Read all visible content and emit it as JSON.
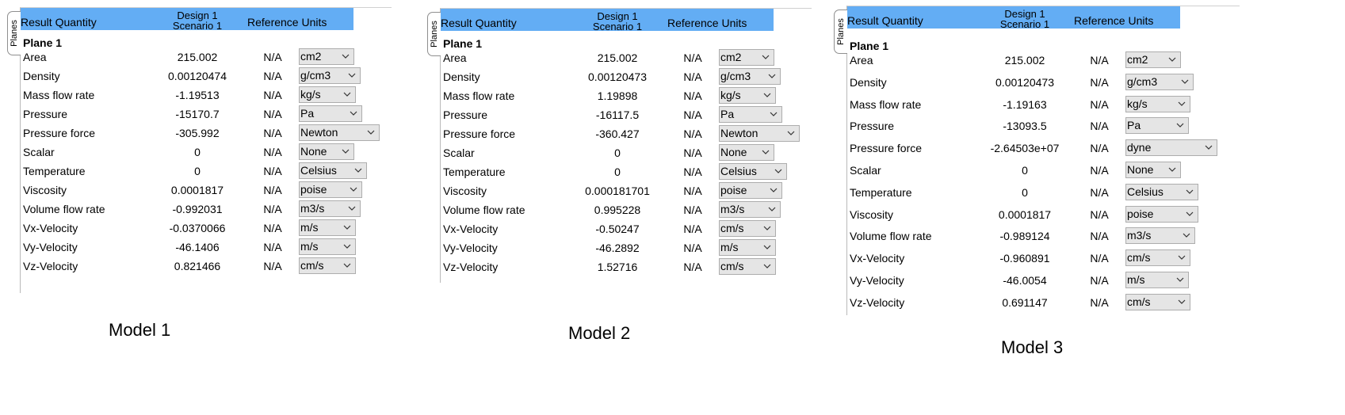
{
  "tab_label": "Planes",
  "columns": {
    "quantity": "Result Quantity",
    "design_line1": "Design 1",
    "design_line2": "Scenario 1",
    "reference": "Reference Units"
  },
  "models": [
    {
      "caption": "Model 1",
      "plane": "Plane 1",
      "rows": [
        {
          "quantity": "Area",
          "value": "215.002",
          "reference": "N/A",
          "unit": "cm2"
        },
        {
          "quantity": "Density",
          "value": "0.00120474",
          "reference": "N/A",
          "unit": "g/cm3"
        },
        {
          "quantity": "Mass flow rate",
          "value": "-1.19513",
          "reference": "N/A",
          "unit": "kg/s"
        },
        {
          "quantity": "Pressure",
          "value": "-15170.7",
          "reference": "N/A",
          "unit": "Pa"
        },
        {
          "quantity": "Pressure force",
          "value": "-305.992",
          "reference": "N/A",
          "unit": "Newton"
        },
        {
          "quantity": "Scalar",
          "value": "0",
          "reference": "N/A",
          "unit": "None"
        },
        {
          "quantity": "Temperature",
          "value": "0",
          "reference": "N/A",
          "unit": "Celsius"
        },
        {
          "quantity": "Viscosity",
          "value": "0.0001817",
          "reference": "N/A",
          "unit": "poise"
        },
        {
          "quantity": "Volume flow rate",
          "value": "-0.992031",
          "reference": "N/A",
          "unit": "m3/s"
        },
        {
          "quantity": "Vx-Velocity",
          "value": "-0.0370066",
          "reference": "N/A",
          "unit": "m/s"
        },
        {
          "quantity": "Vy-Velocity",
          "value": "-46.1406",
          "reference": "N/A",
          "unit": "m/s"
        },
        {
          "quantity": "Vz-Velocity",
          "value": "0.821466",
          "reference": "N/A",
          "unit": "cm/s"
        }
      ]
    },
    {
      "caption": "Model 2",
      "plane": "Plane 1",
      "rows": [
        {
          "quantity": "Area",
          "value": "215.002",
          "reference": "N/A",
          "unit": "cm2"
        },
        {
          "quantity": "Density",
          "value": "0.00120473",
          "reference": "N/A",
          "unit": "g/cm3"
        },
        {
          "quantity": "Mass flow rate",
          "value": "1.19898",
          "reference": "N/A",
          "unit": "kg/s"
        },
        {
          "quantity": "Pressure",
          "value": "-16117.5",
          "reference": "N/A",
          "unit": "Pa"
        },
        {
          "quantity": "Pressure force",
          "value": "-360.427",
          "reference": "N/A",
          "unit": "Newton"
        },
        {
          "quantity": "Scalar",
          "value": "0",
          "reference": "N/A",
          "unit": "None"
        },
        {
          "quantity": "Temperature",
          "value": "0",
          "reference": "N/A",
          "unit": "Celsius"
        },
        {
          "quantity": "Viscosity",
          "value": "0.000181701",
          "reference": "N/A",
          "unit": "poise"
        },
        {
          "quantity": "Volume flow rate",
          "value": "0.995228",
          "reference": "N/A",
          "unit": "m3/s"
        },
        {
          "quantity": "Vx-Velocity",
          "value": "-0.50247",
          "reference": "N/A",
          "unit": "cm/s"
        },
        {
          "quantity": "Vy-Velocity",
          "value": "-46.2892",
          "reference": "N/A",
          "unit": "m/s"
        },
        {
          "quantity": "Vz-Velocity",
          "value": "1.52716",
          "reference": "N/A",
          "unit": "cm/s"
        }
      ]
    },
    {
      "caption": "Model 3",
      "plane": "Plane 1",
      "rows": [
        {
          "quantity": "Area",
          "value": "215.002",
          "reference": "N/A",
          "unit": "cm2"
        },
        {
          "quantity": "Density",
          "value": "0.00120473",
          "reference": "N/A",
          "unit": "g/cm3"
        },
        {
          "quantity": "Mass flow rate",
          "value": "-1.19163",
          "reference": "N/A",
          "unit": "kg/s"
        },
        {
          "quantity": "Pressure",
          "value": "-13093.5",
          "reference": "N/A",
          "unit": "Pa"
        },
        {
          "quantity": "Pressure force",
          "value": "-2.64503e+07",
          "reference": "N/A",
          "unit": "dyne"
        },
        {
          "quantity": "Scalar",
          "value": "0",
          "reference": "N/A",
          "unit": "None"
        },
        {
          "quantity": "Temperature",
          "value": "0",
          "reference": "N/A",
          "unit": "Celsius"
        },
        {
          "quantity": "Viscosity",
          "value": "0.0001817",
          "reference": "N/A",
          "unit": "poise"
        },
        {
          "quantity": "Volume flow rate",
          "value": "-0.989124",
          "reference": "N/A",
          "unit": "m3/s"
        },
        {
          "quantity": "Vx-Velocity",
          "value": "-0.960891",
          "reference": "N/A",
          "unit": "cm/s"
        },
        {
          "quantity": "Vy-Velocity",
          "value": "-46.0054",
          "reference": "N/A",
          "unit": "m/s"
        },
        {
          "quantity": "Vz-Velocity",
          "value": "0.691147",
          "reference": "N/A",
          "unit": "cm/s"
        }
      ]
    }
  ],
  "colors": {
    "header_blue": "#63adf4",
    "dropdown_bg": "#e5e5e5",
    "dropdown_border": "#adadad",
    "panel_bg": "#ffffff"
  },
  "icons": {
    "dropdown": "chevron-down-icon"
  }
}
